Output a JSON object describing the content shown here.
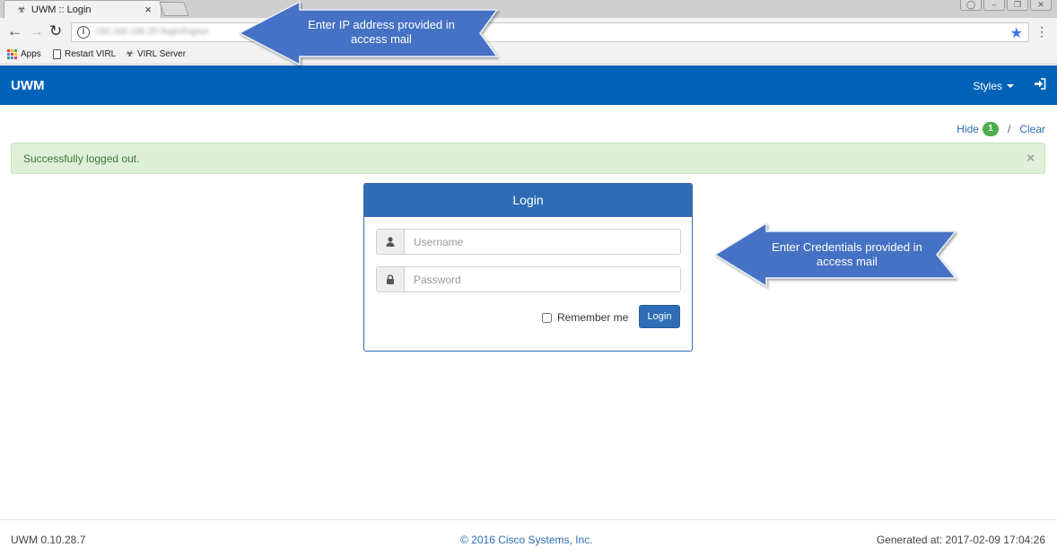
{
  "browser": {
    "tab_title": "UWM :: Login",
    "tab_close": "×",
    "url": "192.168.196.25 /login/logout",
    "bookmarks": [
      {
        "label": "Apps",
        "icon": "apps-grid-icon"
      },
      {
        "label": "Restart VIRL",
        "icon": "page-icon"
      },
      {
        "label": "VIRL Server",
        "icon": "biohazard-icon"
      }
    ]
  },
  "navbar": {
    "brand": "UWM",
    "styles_label": "Styles"
  },
  "messages": {
    "hide_label": "Hide",
    "count": "1",
    "separator": "/",
    "clear_label": "Clear"
  },
  "alert": {
    "text": "Successfully logged out.",
    "close": "×"
  },
  "login": {
    "title": "Login",
    "username_placeholder": "Username",
    "password_placeholder": "Password",
    "remember_label": "Remember me",
    "button_label": "Login"
  },
  "callouts": {
    "ip": "Enter IP address provided in access mail",
    "credentials": "Enter Credentials provided in access mail"
  },
  "footer": {
    "version": "UWM 0.10.28.7",
    "copyright": "© 2016 Cisco Systems, Inc.",
    "generated": "Generated at: 2017-02-09 17:04:26"
  },
  "colors": {
    "navbar": "#0063b7",
    "panel": "#2e6db6",
    "alert_bg": "#dff0d8",
    "alert_text": "#3c763d",
    "badge": "#4cae4c",
    "callout": "#4472c4"
  }
}
